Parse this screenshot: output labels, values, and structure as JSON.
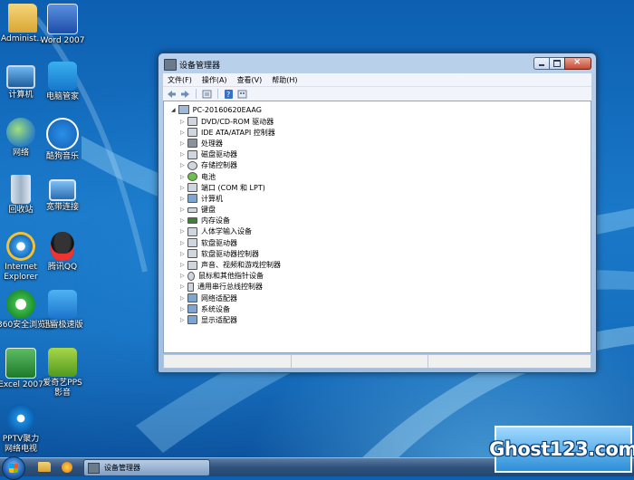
{
  "desktop": {
    "icons": [
      {
        "label": "Administ...",
        "icon": "user-folder-icon"
      },
      {
        "label": "Word 2007",
        "icon": "word-icon"
      },
      {
        "label": "计算机",
        "icon": "computer-icon"
      },
      {
        "label": "电脑管家",
        "icon": "pc-manager-icon"
      },
      {
        "label": "网络",
        "icon": "network-icon"
      },
      {
        "label": "酷狗音乐",
        "icon": "kugou-icon"
      },
      {
        "label": "回收站",
        "icon": "recycle-bin-icon"
      },
      {
        "label": "宽带连接",
        "icon": "broadband-icon"
      },
      {
        "label": "Internet Explorer",
        "line1": "Internet",
        "line2": "Explorer",
        "icon": "ie-icon"
      },
      {
        "label": "腾讯QQ",
        "icon": "qq-icon"
      },
      {
        "label": "360安全浏览器",
        "icon": "360-browser-icon"
      },
      {
        "label": "迅雷极速版",
        "icon": "thunder-icon"
      },
      {
        "label": "Excel 2007",
        "icon": "excel-icon"
      },
      {
        "label": "爱奇艺PPS影音",
        "line1": "爱奇艺PPS",
        "line2": "影音",
        "icon": "pps-icon"
      },
      {
        "label": "PPTV聚力网络电视",
        "line1": "PPTV聚力",
        "line2": "网络电视",
        "icon": "pptv-icon"
      }
    ]
  },
  "window": {
    "title": "设备管理器",
    "menu": [
      "文件(F)",
      "操作(A)",
      "查看(V)",
      "帮助(H)"
    ],
    "tree": {
      "root": "PC-20160620EAAG",
      "items": [
        {
          "label": "DVD/CD-ROM 驱动器",
          "icon": "dvd-icon"
        },
        {
          "label": "IDE ATA/ATAPI 控制器",
          "icon": "ide-icon"
        },
        {
          "label": "处理器",
          "icon": "cpu-icon"
        },
        {
          "label": "磁盘驱动器",
          "icon": "disk-icon"
        },
        {
          "label": "存储控制器",
          "icon": "storage-icon"
        },
        {
          "label": "电池",
          "icon": "battery-icon"
        },
        {
          "label": "端口 (COM 和 LPT)",
          "icon": "port-icon"
        },
        {
          "label": "计算机",
          "icon": "computer-icon"
        },
        {
          "label": "键盘",
          "icon": "keyboard-icon"
        },
        {
          "label": "内存设备",
          "icon": "memory-icon"
        },
        {
          "label": "人体学输入设备",
          "icon": "hid-icon"
        },
        {
          "label": "软盘驱动器",
          "icon": "floppy-icon"
        },
        {
          "label": "软盘驱动器控制器",
          "icon": "floppy-controller-icon"
        },
        {
          "label": "声音、视频和游戏控制器",
          "icon": "sound-icon"
        },
        {
          "label": "鼠标和其他指针设备",
          "icon": "mouse-icon"
        },
        {
          "label": "通用串行总线控制器",
          "icon": "usb-icon"
        },
        {
          "label": "网络适配器",
          "icon": "network-adapter-icon"
        },
        {
          "label": "系统设备",
          "icon": "system-device-icon"
        },
        {
          "label": "显示适配器",
          "icon": "display-adapter-icon"
        }
      ]
    }
  },
  "taskbar": {
    "task_label": "设备管理器"
  },
  "watermark": {
    "text": "Ghost123.com"
  },
  "colors": {
    "desktop": "#1670c0",
    "window_frame": "#a9c6e6",
    "taskbar": "#2f527c",
    "watermark_bg": "#2d8fd8"
  }
}
